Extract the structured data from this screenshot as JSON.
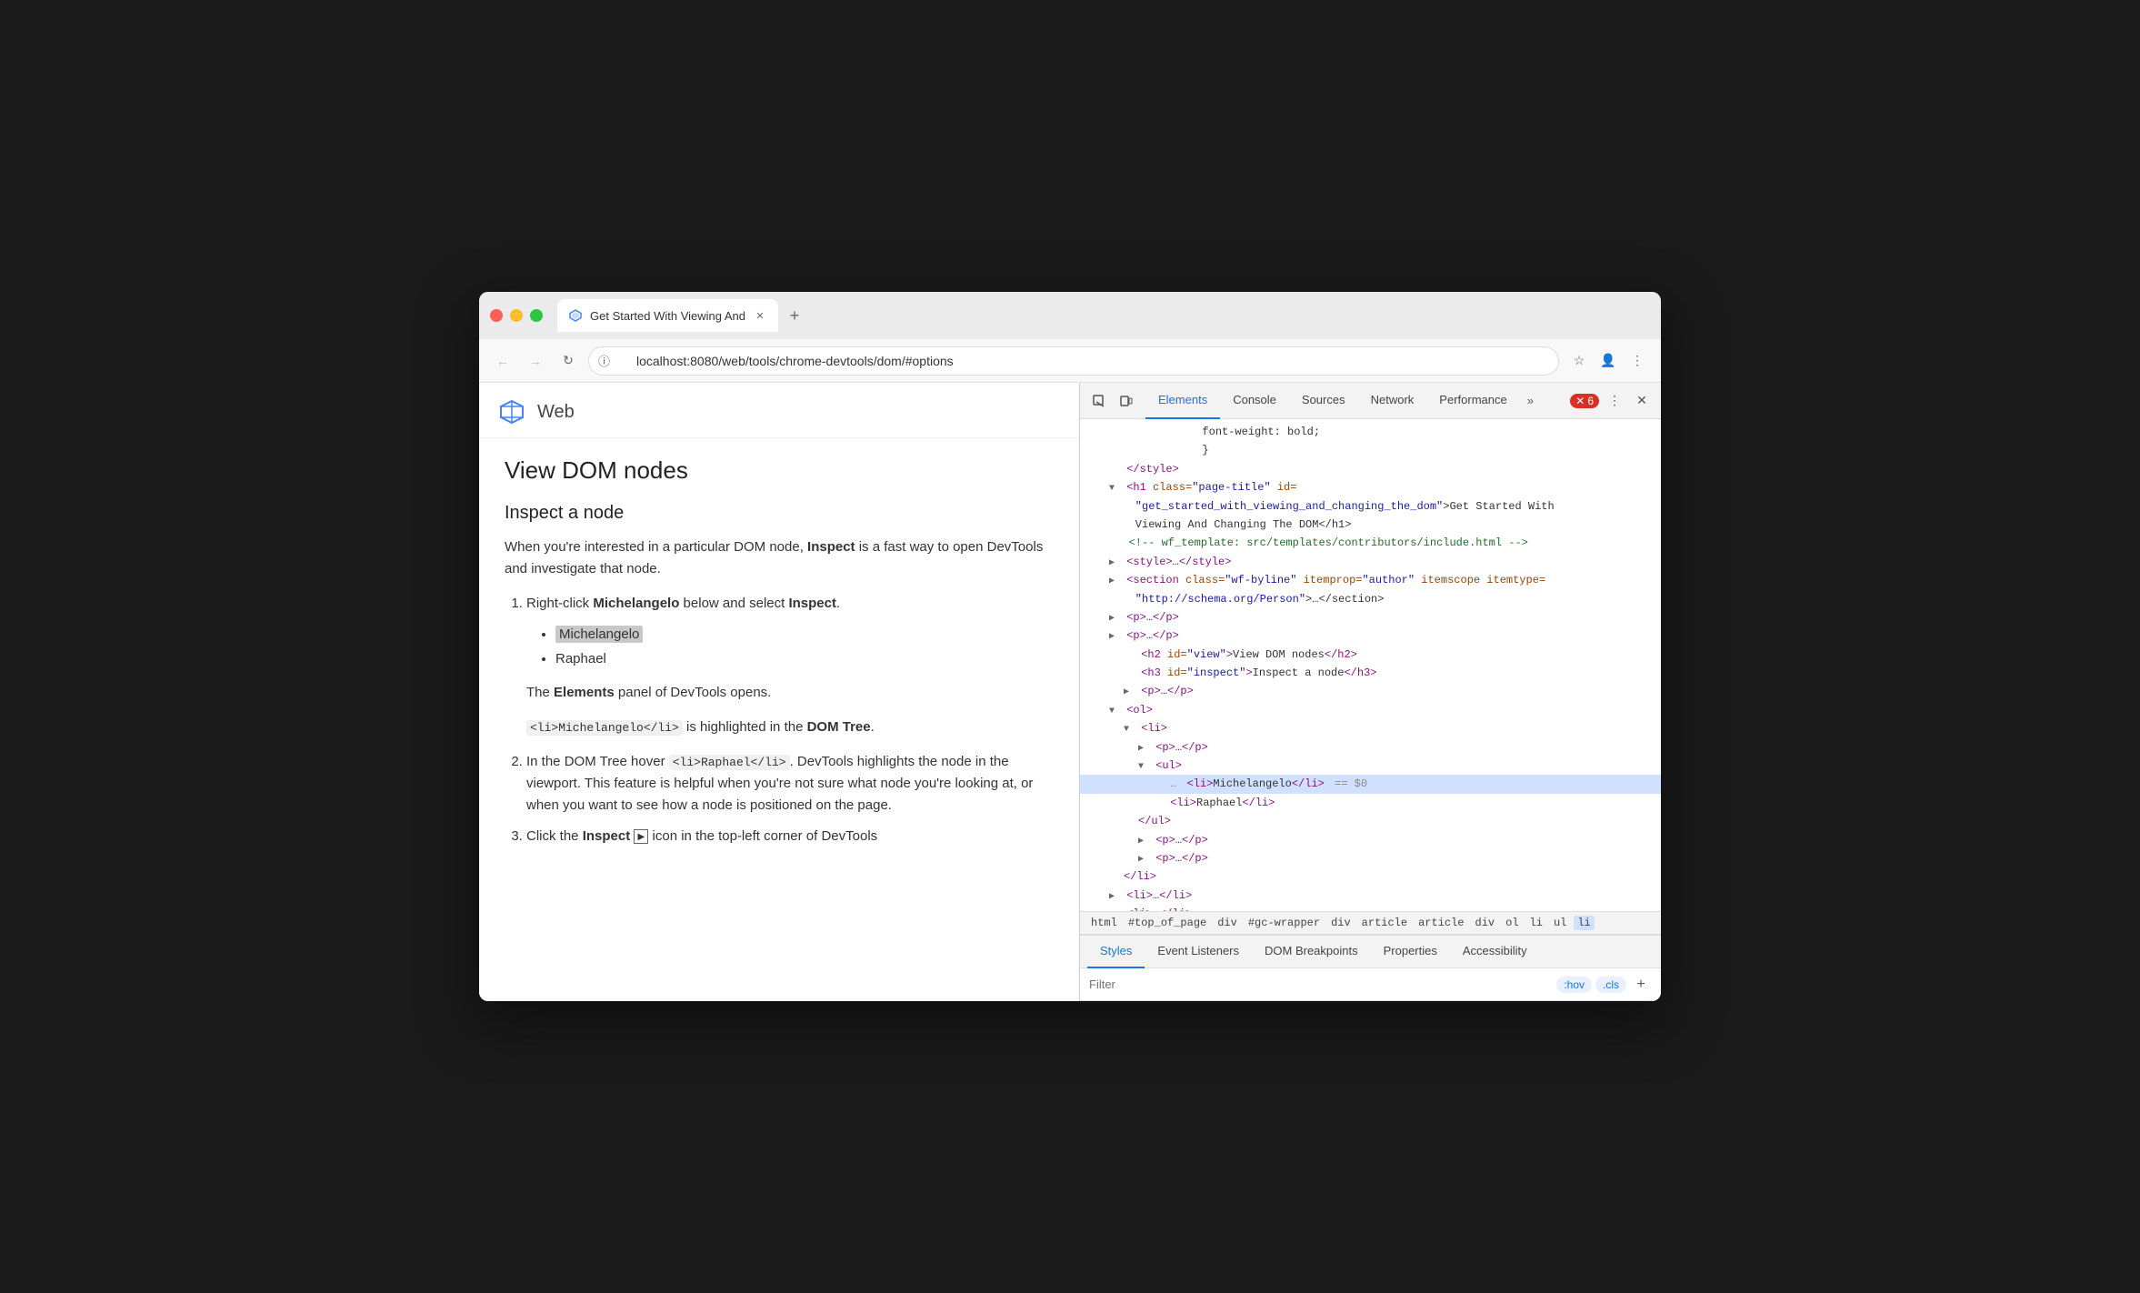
{
  "browser": {
    "tab_title": "Get Started With Viewing And",
    "url": "localhost:8080/web/tools/chrome-devtools/dom/#options",
    "new_tab_label": "+",
    "back_label": "←",
    "forward_label": "→",
    "reload_label": "↻"
  },
  "site": {
    "logo_alt": "Web",
    "name": "Web"
  },
  "page": {
    "h2": "View DOM nodes",
    "h3": "Inspect a node",
    "p1": "When you're interested in a particular DOM node, Inspect is a fast way to open DevTools and investigate that node.",
    "ol": [
      {
        "text_prefix": "Right-click ",
        "bold1": "Michelangelo",
        "text_mid": " below and select ",
        "bold2": "Inspect",
        "text_suffix": ".",
        "subitems": [
          "Michelangelo",
          "Raphael"
        ],
        "extra": "The Elements panel of DevTools opens.",
        "code": "<li>Michelangelo</li>",
        "code_suffix": " is highlighted in the DOM Tree."
      },
      {
        "text_prefix": "In the DOM Tree hover ",
        "code": "<li>Raphael</li>",
        "text_suffix": ". DevTools highlights the node in the viewport. This feature is helpful when you're not sure what node you're looking at, or when you want to see how a node is positioned on the page."
      },
      {
        "text_prefix": "Click the ",
        "bold": "Inspect",
        "text_suffix": " icon in the top-left corner of DevTools"
      }
    ]
  },
  "devtools": {
    "tabs": [
      {
        "label": "Elements",
        "active": true
      },
      {
        "label": "Console",
        "active": false
      },
      {
        "label": "Sources",
        "active": false
      },
      {
        "label": "Network",
        "active": false
      },
      {
        "label": "Performance",
        "active": false
      }
    ],
    "more_label": "»",
    "error_count": "6",
    "close_label": "✕",
    "dom_lines": [
      {
        "indent": 2,
        "content": "font-weight: bold;",
        "type": "css"
      },
      {
        "indent": 2,
        "content": "}",
        "type": "css"
      },
      {
        "indent": 1,
        "content": "</style>",
        "type": "tag",
        "triangle": "empty"
      },
      {
        "indent": 1,
        "content": "<h1 class=\"page-title\" id=",
        "type": "tag",
        "triangle": "open"
      },
      {
        "indent": 1,
        "content": "\"get_started_with_viewing_and_changing_the_dom\">Get Started With",
        "type": "attr-value"
      },
      {
        "indent": 1,
        "content": "Viewing And Changing The DOM</h1>",
        "type": "dom-text"
      },
      {
        "indent": 1,
        "content": "<!-- wf_template: src/templates/contributors/include.html -->",
        "type": "comment"
      },
      {
        "indent": 1,
        "content": "<style>…</style>",
        "type": "tag",
        "triangle": "closed"
      },
      {
        "indent": 1,
        "content": "<section class=\"wf-byline\" itemprop=\"author\" itemscope itemtype=",
        "type": "tag",
        "triangle": "closed"
      },
      {
        "indent": 1,
        "content": "\"http://schema.org/Person\">…</section>",
        "type": "attr-value"
      },
      {
        "indent": 1,
        "content": "<p>…</p>",
        "type": "tag",
        "triangle": "closed"
      },
      {
        "indent": 1,
        "content": "<p>…</p>",
        "type": "tag",
        "triangle": "closed"
      },
      {
        "indent": 2,
        "content": "<h2 id=\"view\">View DOM nodes</h2>",
        "type": "tag",
        "triangle": "empty"
      },
      {
        "indent": 2,
        "content": "<h3 id=\"inspect\">Inspect a node</h3>",
        "type": "tag",
        "triangle": "empty"
      },
      {
        "indent": 2,
        "content": "<p>…</p>",
        "type": "tag",
        "triangle": "closed"
      },
      {
        "indent": 1,
        "content": "<ol>",
        "type": "tag",
        "triangle": "open"
      },
      {
        "indent": 2,
        "content": "<li>",
        "type": "tag",
        "triangle": "open"
      },
      {
        "indent": 3,
        "content": "<p>…</p>",
        "type": "tag",
        "triangle": "closed"
      },
      {
        "indent": 3,
        "content": "<ul>",
        "type": "tag",
        "triangle": "open"
      },
      {
        "indent": 4,
        "content": "<li>Michelangelo</li> == $0",
        "type": "selected",
        "triangle": "empty"
      },
      {
        "indent": 4,
        "content": "<li>Raphael</li>",
        "type": "tag",
        "triangle": "empty"
      },
      {
        "indent": 3,
        "content": "</ul>",
        "type": "tag"
      },
      {
        "indent": 3,
        "content": "<p>…</p>",
        "type": "tag",
        "triangle": "closed"
      },
      {
        "indent": 3,
        "content": "<p>…</p>",
        "type": "tag",
        "triangle": "closed"
      },
      {
        "indent": 2,
        "content": "</li>",
        "type": "tag"
      },
      {
        "indent": 1,
        "content": "<li>…</li>",
        "type": "tag",
        "triangle": "closed"
      },
      {
        "indent": 1,
        "content": "<li>…</li>",
        "type": "tag",
        "triangle": "closed"
      }
    ],
    "breadcrumb": [
      "html",
      "#top_of_page",
      "div",
      "#gc-wrapper",
      "div",
      "article",
      "article",
      "div",
      "ol",
      "li",
      "ul",
      "li"
    ],
    "bottom_tabs": [
      {
        "label": "Styles",
        "active": true
      },
      {
        "label": "Event Listeners",
        "active": false
      },
      {
        "label": "DOM Breakpoints",
        "active": false
      },
      {
        "label": "Properties",
        "active": false
      },
      {
        "label": "Accessibility",
        "active": false
      }
    ],
    "filter_placeholder": "Filter",
    "filter_hov": ":hov",
    "filter_cls": ".cls",
    "filter_plus": "+"
  }
}
